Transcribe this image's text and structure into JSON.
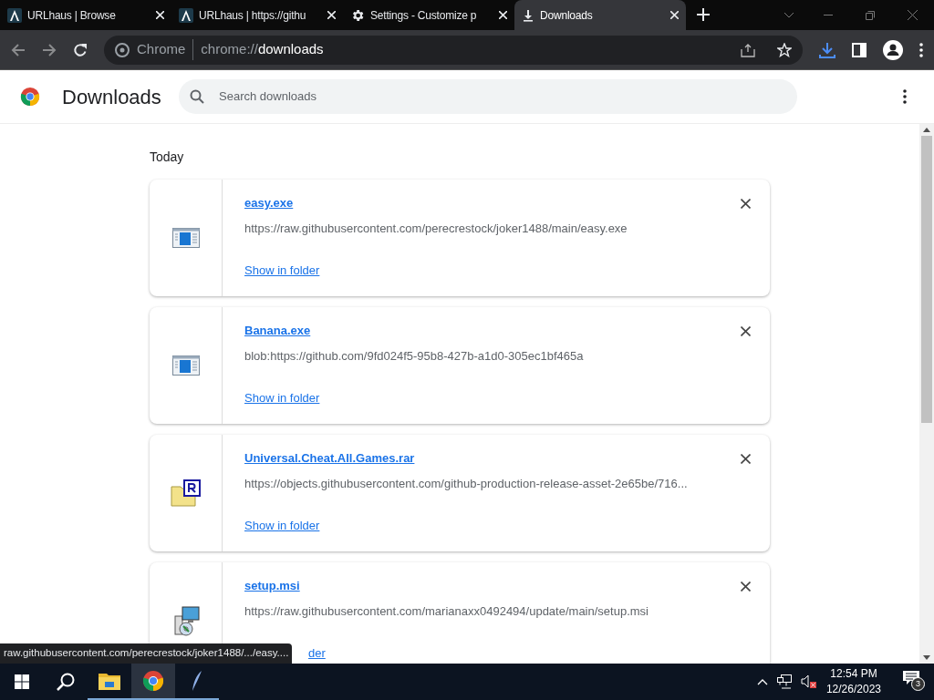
{
  "tabs": [
    {
      "title": "URLhaus | Browse",
      "kind": "urlhaus",
      "selected": false
    },
    {
      "title": "URLhaus | https://githu",
      "kind": "urlhaus",
      "selected": false
    },
    {
      "title": "Settings - Customize p",
      "kind": "settings",
      "selected": false
    },
    {
      "title": "Downloads",
      "kind": "download",
      "selected": true
    }
  ],
  "omnibox": {
    "chip": "Chrome",
    "url_prefix": "chrome://",
    "url_host": "downloads"
  },
  "page": {
    "title": "Downloads",
    "search": {
      "placeholder": "Search downloads"
    }
  },
  "section": "Today",
  "downloads": [
    {
      "name": "easy.exe",
      "kind": "exe",
      "url": "https://raw.githubusercontent.com/perecrestock/joker1488/main/easy.exe",
      "action": "Show in folder"
    },
    {
      "name": "Banana.exe",
      "kind": "exe",
      "url": "blob:https://github.com/9fd024f5-95b8-427b-a1d0-305ec1bf465a",
      "action": "Show in folder"
    },
    {
      "name": "Universal.Cheat.All.Games.rar",
      "kind": "rar",
      "url": "https://objects.githubusercontent.com/github-production-release-asset-2e65be/716...",
      "action": "Show in folder"
    },
    {
      "name": "setup.msi",
      "kind": "msi",
      "url": "https://raw.githubusercontent.com/marianaxx0492494/update/main/setup.msi",
      "action": "der",
      "action_covered": true
    }
  ],
  "status_bubble": "raw.githubusercontent.com/perecrestock/joker1488/.../easy....",
  "taskbar": {
    "apps": [
      {
        "kind": "explorer",
        "selected": false
      },
      {
        "kind": "chrome",
        "selected": true
      },
      {
        "kind": "pen",
        "selected": false
      }
    ],
    "time": "12:54 PM",
    "date": "12/26/2023",
    "notifications": "3"
  }
}
